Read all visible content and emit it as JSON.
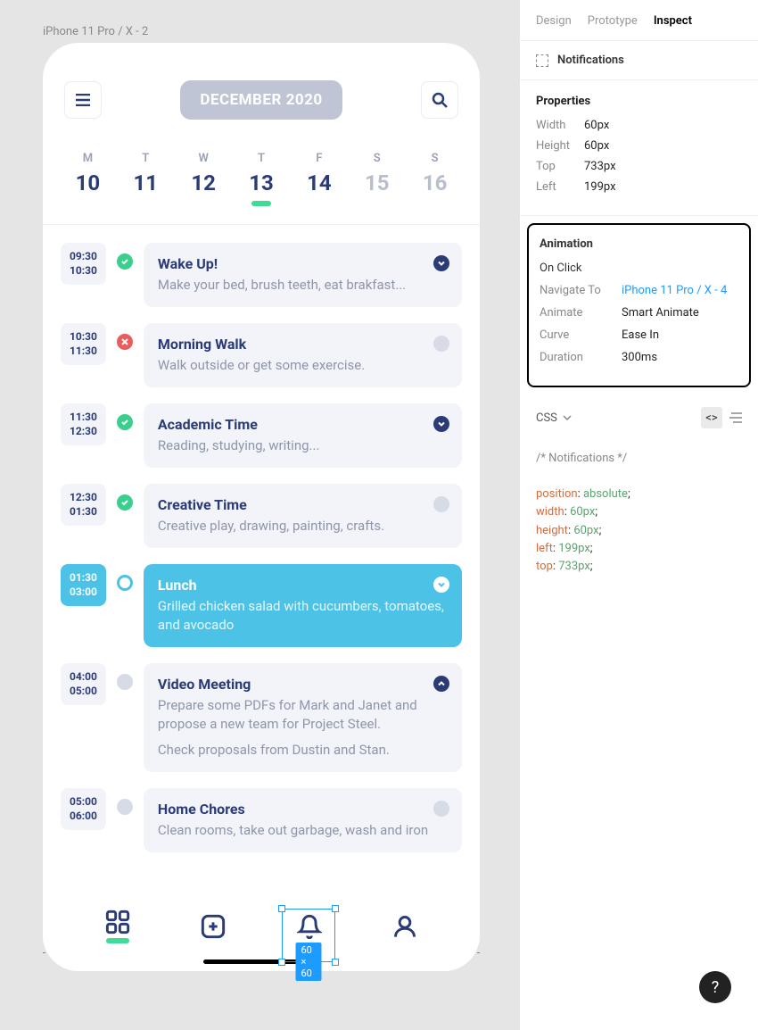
{
  "frame_label": "iPhone 11 Pro / X - 2",
  "header": {
    "month": "DECEMBER 2020"
  },
  "days": [
    {
      "letter": "M",
      "num": "10",
      "dark": true,
      "today": false
    },
    {
      "letter": "T",
      "num": "11",
      "dark": true,
      "today": false
    },
    {
      "letter": "W",
      "num": "12",
      "dark": true,
      "today": false
    },
    {
      "letter": "T",
      "num": "13",
      "dark": true,
      "today": true
    },
    {
      "letter": "F",
      "num": "14",
      "dark": true,
      "today": false
    },
    {
      "letter": "S",
      "num": "15",
      "dark": false,
      "today": false
    },
    {
      "letter": "S",
      "num": "16",
      "dark": false,
      "today": false
    }
  ],
  "events": [
    {
      "start": "09:30",
      "end": "10:30",
      "status": "green",
      "title": "Wake Up!",
      "desc": "Make your bed, brush teeth, eat brakfast...",
      "dot": "blue",
      "active": false
    },
    {
      "start": "10:30",
      "end": "11:30",
      "status": "red",
      "title": "Morning Walk",
      "desc": "Walk outside or get some exercise.",
      "dot": "gray",
      "active": false
    },
    {
      "start": "11:30",
      "end": "12:30",
      "status": "green",
      "title": "Academic Time",
      "desc": "Reading, studying, writing...",
      "dot": "blue",
      "active": false
    },
    {
      "start": "12:30",
      "end": "01:30",
      "status": "green",
      "title": "Creative Time",
      "desc": "Creative play, drawing, painting, crafts.",
      "dot": "gray",
      "active": false
    },
    {
      "start": "01:30",
      "end": "03:00",
      "status": "ring",
      "title": "Lunch",
      "desc": "Grilled chicken salad with cucumbers, tomatoes, and avocado",
      "dot": "white",
      "active": true
    },
    {
      "start": "04:00",
      "end": "05:00",
      "status": "gray",
      "title": "Video Meeting",
      "desc": "Prepare some PDFs for Mark and Janet and propose a new team for Project Steel.\nCheck proposals from Dustin and Stan.",
      "dot": "blue",
      "active": false
    },
    {
      "start": "05:00",
      "end": "06:00",
      "status": "gray",
      "title": "Home Chores",
      "desc": "Clean rooms, take out garbage, wash and iron",
      "dot": "gray",
      "active": false
    }
  ],
  "selection": {
    "size_label": "60 × 60"
  },
  "inspector": {
    "tabs": {
      "design": "Design",
      "prototype": "Prototype",
      "inspect": "Inspect"
    },
    "selection_name": "Notifications",
    "properties": {
      "heading": "Properties",
      "rows": [
        {
          "label": "Width",
          "value": "60px"
        },
        {
          "label": "Height",
          "value": "60px"
        },
        {
          "label": "Top",
          "value": "733px"
        },
        {
          "label": "Left",
          "value": "199px"
        }
      ]
    },
    "animation": {
      "heading": "Animation",
      "trigger": "On Click",
      "rows": [
        {
          "label": "Navigate To",
          "value": "iPhone 11 Pro / X - 4",
          "link": true
        },
        {
          "label": "Animate",
          "value": "Smart Animate",
          "link": false
        },
        {
          "label": "Curve",
          "value": "Ease In",
          "link": false
        },
        {
          "label": "Duration",
          "value": "300ms",
          "link": false
        }
      ]
    },
    "css": {
      "label": "CSS",
      "comment": "/* Notifications */",
      "lines": [
        {
          "prop": "position",
          "val": "absolute",
          "semi": ";"
        },
        {
          "prop": "width",
          "val": "60px",
          "semi": ";"
        },
        {
          "prop": "height",
          "val": "60px",
          "semi": ";"
        },
        {
          "prop": "left",
          "val": "199px",
          "semi": ";"
        },
        {
          "prop": "top",
          "val": "733px",
          "semi": ";"
        }
      ]
    }
  },
  "help": "?"
}
